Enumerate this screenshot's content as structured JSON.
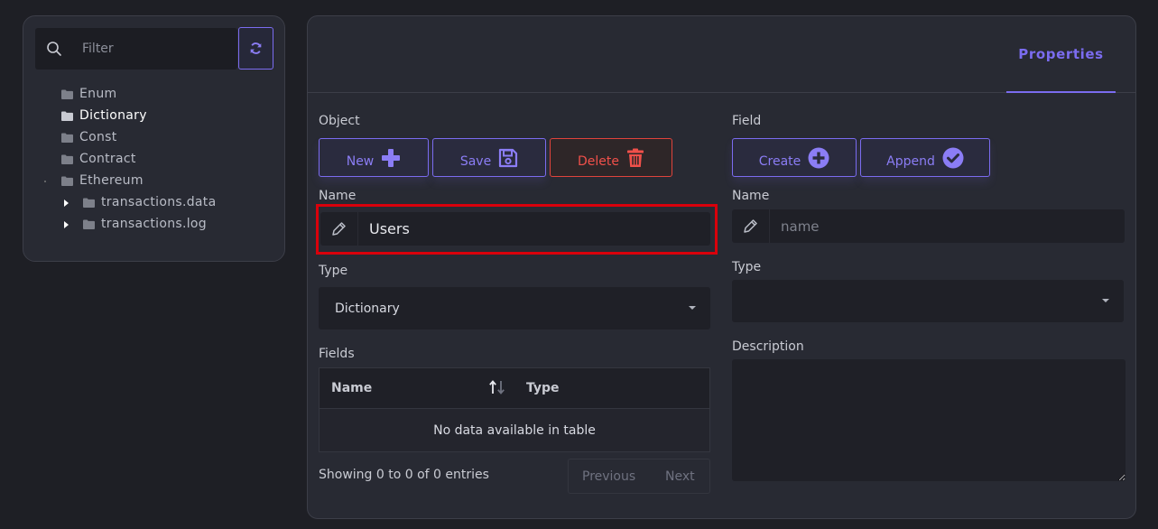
{
  "sidebar": {
    "filter_placeholder": "Filter",
    "tree": [
      {
        "label": "Enum"
      },
      {
        "label": "Dictionary",
        "selected": true
      },
      {
        "label": "Const"
      },
      {
        "label": "Contract"
      },
      {
        "label": "Ethereum"
      },
      {
        "label": "transactions.data"
      },
      {
        "label": "transactions.log"
      }
    ]
  },
  "tabs": {
    "properties": "Properties"
  },
  "object": {
    "section_label": "Object",
    "buttons": {
      "new": "New",
      "save": "Save",
      "delete": "Delete"
    },
    "name_label": "Name",
    "name_value": "Users",
    "type_label": "Type",
    "type_value": "Dictionary",
    "fields_label": "Fields",
    "table": {
      "columns": [
        "Name",
        "Type"
      ],
      "empty_message": "No data available in table"
    },
    "pagination": {
      "info": "Showing 0 to 0 of 0 entries",
      "previous": "Previous",
      "next": "Next"
    }
  },
  "field": {
    "section_label": "Field",
    "buttons": {
      "create": "Create",
      "append": "Append"
    },
    "name_label": "Name",
    "name_placeholder": "name",
    "type_label": "Type",
    "type_value": "",
    "description_label": "Description"
  },
  "colors": {
    "accent": "#7b6cf0",
    "danger": "#f0504a",
    "highlight": "#d9000b",
    "background": "#1e1f25",
    "panel": "#282a33"
  }
}
